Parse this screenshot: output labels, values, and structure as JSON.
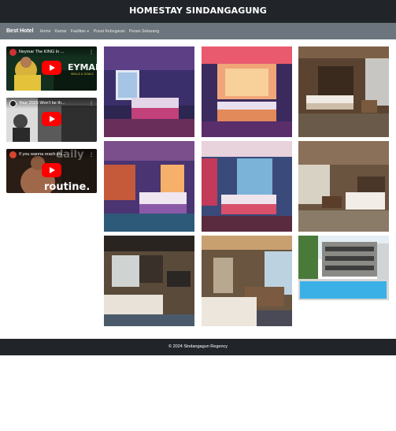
{
  "header": {
    "title": "HOMESTAY SINDANGAGUNG"
  },
  "navbar": {
    "brand": "Best Hotel",
    "items": [
      "Home",
      "Kamar",
      "Fasilitas",
      "Pusat Kebugaran",
      "Pesan Sekarang"
    ]
  },
  "videos": [
    {
      "title": "Neymar The KING In ...",
      "overlay": "EYMAR",
      "overlay_sub": "SKILLS & GOALS"
    },
    {
      "title": "Your 2025 Won't be th..."
    },
    {
      "title": "If you wanna reach su...",
      "overlay": "daily",
      "overlay_sub": "routine."
    }
  ],
  "footer": {
    "text": "© 2024 Sindangagun Regency"
  },
  "colors": {
    "dark": "#212529",
    "nav": "#6c757d",
    "play": "#ff0000"
  }
}
